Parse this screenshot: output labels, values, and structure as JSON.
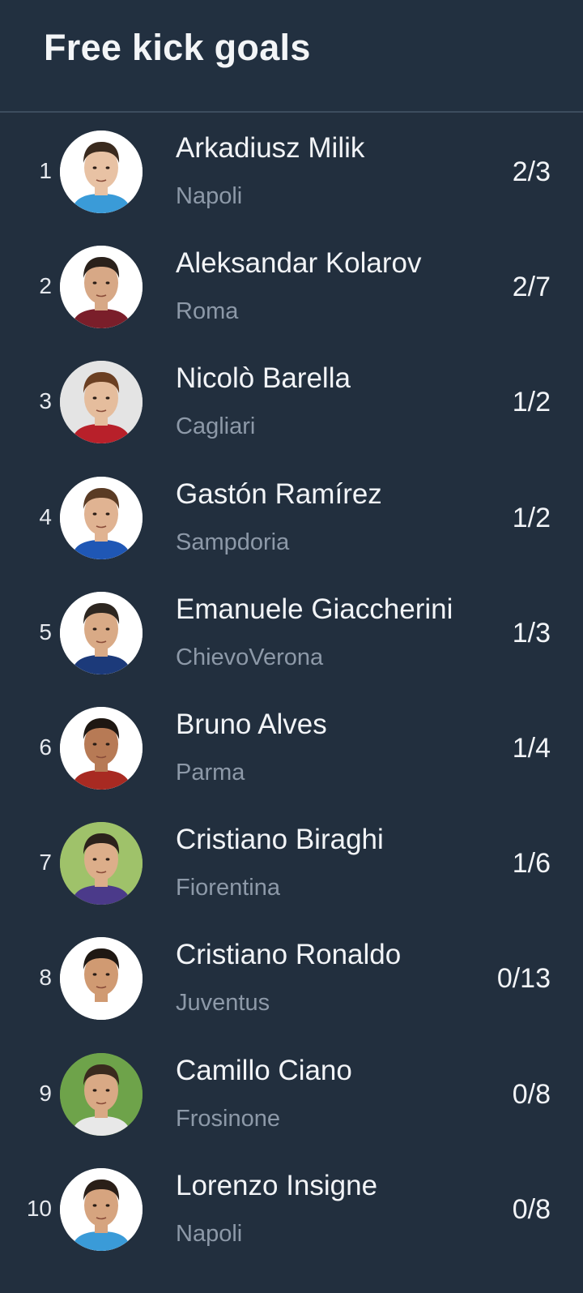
{
  "header": {
    "title": "Free kick goals"
  },
  "players": [
    {
      "rank": "1",
      "name": "Arkadiusz Milik",
      "team": "Napoli",
      "stat": "2/3",
      "avatar_bg": "#ffffff",
      "skin": "#e8c2a4",
      "hair": "#3a2a1e",
      "shirt": "#3a9bd8"
    },
    {
      "rank": "2",
      "name": "Aleksandar Kolarov",
      "team": "Roma",
      "stat": "2/7",
      "avatar_bg": "#ffffff",
      "skin": "#d7a886",
      "hair": "#2a211b",
      "shirt": "#7a1e2a"
    },
    {
      "rank": "3",
      "name": "Nicolò Barella",
      "team": "Cagliari",
      "stat": "1/2",
      "avatar_bg": "#e4e4e4",
      "skin": "#e5bd9d",
      "hair": "#6b3f22",
      "shirt": "#b8202a"
    },
    {
      "rank": "4",
      "name": "Gastón Ramírez",
      "team": "Sampdoria",
      "stat": "1/2",
      "avatar_bg": "#ffffff",
      "skin": "#e0b392",
      "hair": "#5a3b24",
      "shirt": "#1f57b5"
    },
    {
      "rank": "5",
      "name": "Emanuele Giaccherini",
      "team": "ChievoVerona",
      "stat": "1/3",
      "avatar_bg": "#ffffff",
      "skin": "#d9aa86",
      "hair": "#2d2620",
      "shirt": "#1c3a7a"
    },
    {
      "rank": "6",
      "name": "Bruno Alves",
      "team": "Parma",
      "stat": "1/4",
      "avatar_bg": "#ffffff",
      "skin": "#b77a55",
      "hair": "#1e1712",
      "shirt": "#a82a22"
    },
    {
      "rank": "7",
      "name": "Cristiano Biraghi",
      "team": "Fiorentina",
      "stat": "1/6",
      "avatar_bg": "#9fc26a",
      "skin": "#dcae8a",
      "hair": "#2b221b",
      "shirt": "#4b3a8a"
    },
    {
      "rank": "8",
      "name": "Cristiano Ronaldo",
      "team": "Juventus",
      "stat": "0/13",
      "avatar_bg": "#ffffff",
      "skin": "#d09a72",
      "hair": "#1f1813",
      "shirt": "#ffffff"
    },
    {
      "rank": "9",
      "name": "Camillo Ciano",
      "team": "Frosinone",
      "stat": "0/8",
      "avatar_bg": "#6ea34a",
      "skin": "#d9a985",
      "hair": "#3a2a1e",
      "shirt": "#e8e8e8"
    },
    {
      "rank": "10",
      "name": "Lorenzo Insigne",
      "team": "Napoli",
      "stat": "0/8",
      "avatar_bg": "#ffffff",
      "skin": "#d6a47f",
      "hair": "#2a1f18",
      "shirt": "#3a9bd8"
    }
  ]
}
